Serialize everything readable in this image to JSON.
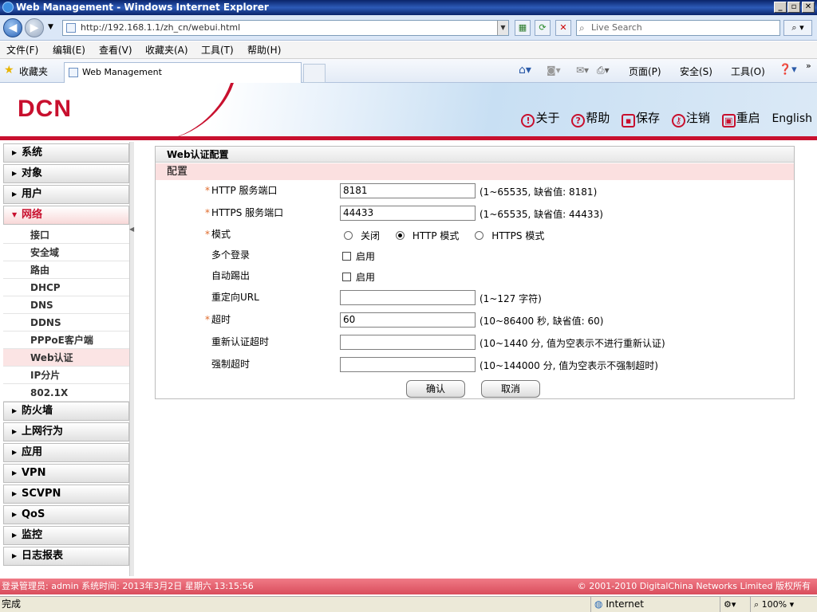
{
  "window": {
    "title": "Web Management - Windows Internet Explorer"
  },
  "address_bar": {
    "url": "http://192.168.1.1/zh_cn/webui.html",
    "search_placeholder": "Live Search"
  },
  "menu": [
    "文件(F)",
    "编辑(E)",
    "查看(V)",
    "收藏夹(A)",
    "工具(T)",
    "帮助(H)"
  ],
  "favorites": {
    "label": "收藏夹",
    "tab_title": "Web Management"
  },
  "ie_toolbar": {
    "page": "页面(P)",
    "safety": "安全(S)",
    "tools": "工具(O)"
  },
  "header": {
    "logo": "DCN",
    "links": {
      "about": "关于",
      "help": "帮助",
      "save": "保存",
      "logout": "注销",
      "reboot": "重启",
      "language": "English"
    }
  },
  "sidebar": {
    "top": [
      "系统",
      "对象",
      "用户"
    ],
    "active": "网络",
    "sub": [
      "接口",
      "安全域",
      "路由",
      "DHCP",
      "DNS",
      "DDNS",
      "PPPoE客户端",
      "Web认证",
      "IP分片",
      "802.1X"
    ],
    "bottom": [
      "防火墙",
      "上网行为",
      "应用",
      "VPN",
      "SCVPN",
      "QoS",
      "监控",
      "日志报表"
    ]
  },
  "panel": {
    "title": "Web认证配置",
    "section": "配置",
    "http_port": {
      "label": "HTTP 服务端口",
      "value": "8181",
      "hint": "(1~65535, 缺省值: 8181)"
    },
    "https_port": {
      "label": "HTTPS 服务端口",
      "value": "44433",
      "hint": "(1~65535, 缺省值: 44433)"
    },
    "mode": {
      "label": "模式",
      "options": [
        "关闭",
        "HTTP 模式",
        "HTTPS 模式"
      ],
      "selected": "HTTP 模式"
    },
    "multi_login": {
      "label": "多个登录",
      "option": "启用"
    },
    "auto_kick": {
      "label": "自动踢出",
      "option": "启用"
    },
    "redirect_url": {
      "label": "重定向URL",
      "value": "",
      "hint": "(1~127 字符)"
    },
    "timeout": {
      "label": "超时",
      "value": "60",
      "hint": "(10~86400 秒, 缺省值: 60)"
    },
    "reauth_timeout": {
      "label": "重新认证超时",
      "value": "",
      "hint": "(10~1440 分, 值为空表示不进行重新认证)"
    },
    "force_timeout": {
      "label": "强制超时",
      "value": "",
      "hint": "(10~144000 分, 值为空表示不强制超时)"
    },
    "ok_button": "确认",
    "cancel_button": "取消"
  },
  "footer": {
    "left": "登录管理员: admin 系统时间: 2013年3月2日 星期六 13:15:56",
    "right": "© 2001-2010 DigitalChina Networks Limited 版权所有"
  },
  "statusbar": {
    "status": "完成",
    "zone": "Internet",
    "zoom": "100%"
  }
}
